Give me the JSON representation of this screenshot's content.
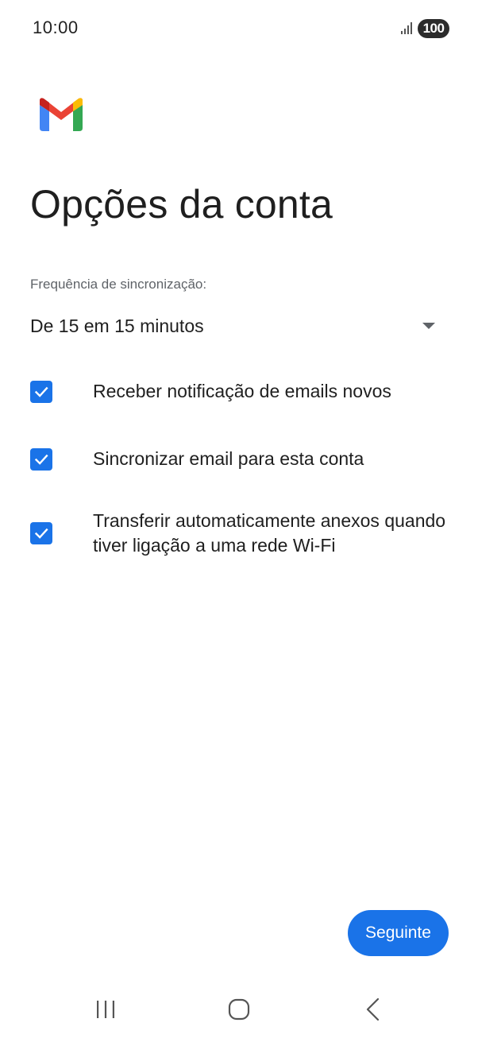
{
  "status_bar": {
    "time": "10:00",
    "battery": "100",
    "signal_icon": "signal-bars-icon"
  },
  "app": {
    "logo": "gmail-logo",
    "colors": {
      "accent": "#1a73e8",
      "gmail_red": "#ea4335",
      "gmail_blue": "#4285f4",
      "gmail_green": "#34a853",
      "gmail_yellow": "#fbbc04"
    }
  },
  "page": {
    "title": "Opções da conta"
  },
  "sync": {
    "label": "Frequência de sincronização:",
    "selected": "De 15 em 15 minutos",
    "dropdown_icon": "dropdown-arrow-icon"
  },
  "options": [
    {
      "label": "Receber notificação de emails novos",
      "checked": true
    },
    {
      "label": "Sincronizar email para esta conta",
      "checked": true
    },
    {
      "label": "Transferir automaticamente anexos quando tiver ligação a uma rede Wi-Fi",
      "checked": true
    }
  ],
  "actions": {
    "next_label": "Seguinte"
  },
  "navigation": {
    "recents_icon": "recent-apps-icon",
    "home_icon": "home-icon",
    "back_icon": "back-icon"
  }
}
